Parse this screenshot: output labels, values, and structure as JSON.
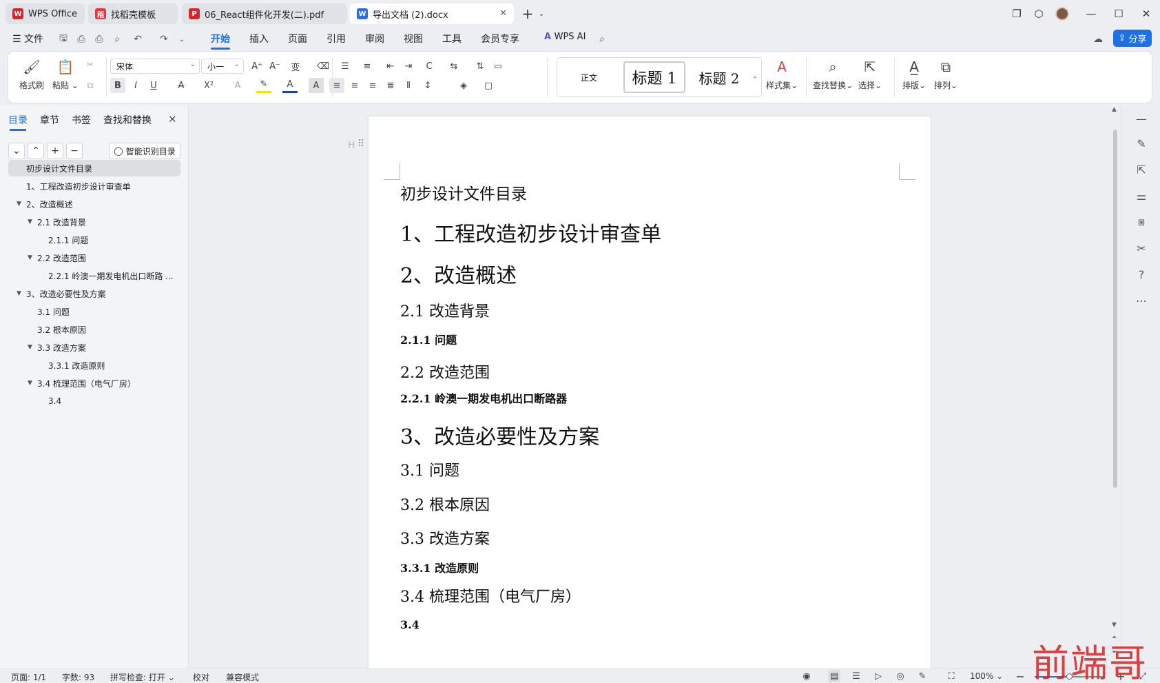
{
  "tabs": [
    {
      "label": "WPS Office",
      "icon": "W",
      "color": "#d7252c"
    },
    {
      "label": "找稻壳模板",
      "icon": "稻",
      "color": "#e6393f"
    },
    {
      "label": "06_React组件化开发(二).pdf",
      "icon": "P",
      "color": "#d7252c"
    },
    {
      "label": "导出文档 (2).docx",
      "icon": "W",
      "color": "#2b6de8"
    }
  ],
  "menu": {
    "file": "文件",
    "items": [
      "开始",
      "插入",
      "页面",
      "引用",
      "审阅",
      "视图",
      "工具",
      "会员专享"
    ],
    "active": "开始",
    "wps_ai": "WPS AI",
    "share": "分享"
  },
  "ribbon": {
    "format_painter": "格式刷",
    "paste": "粘贴",
    "font_name": "宋体",
    "font_size": "小一",
    "styles": {
      "normal": "正文",
      "h1": "标题 1",
      "h2": "标题 2"
    },
    "style_set": "样式集",
    "find_replace": "查找替换",
    "select": "选择",
    "layout": "排版",
    "arrange": "排列"
  },
  "navpane": {
    "tabs": [
      "目录",
      "章节",
      "书签",
      "查找和替换"
    ],
    "active_tab": "目录",
    "smart_button": "智能识别目录",
    "items": [
      {
        "label": "初步设计文件目录",
        "level": 0,
        "selected": true,
        "caret": false
      },
      {
        "label": "1、工程改造初步设计审查单",
        "level": 1,
        "caret": false
      },
      {
        "label": "2、改造概述",
        "level": 1,
        "caret": true
      },
      {
        "label": "2.1  改造背景",
        "level": 2,
        "caret": true
      },
      {
        "label": "2.1.1  问题",
        "level": 3,
        "caret": false
      },
      {
        "label": "2.2  改造范围",
        "level": 2,
        "caret": true
      },
      {
        "label": "2.2.1  岭澳一期发电机出口断路 ...",
        "level": 3,
        "caret": false
      },
      {
        "label": "3、改造必要性及方案",
        "level": 1,
        "caret": true
      },
      {
        "label": "3.1 问题",
        "level": 2,
        "caret": false
      },
      {
        "label": "3.2 根本原因",
        "level": 2,
        "caret": false
      },
      {
        "label": "3.3 改造方案",
        "level": 2,
        "caret": true
      },
      {
        "label": "3.3.1 改造原则",
        "level": 3,
        "caret": false
      },
      {
        "label": "3.4 梳理范围（电气厂房）",
        "level": 2,
        "caret": true
      },
      {
        "label": "3.4",
        "level": 3,
        "caret": false
      }
    ]
  },
  "document": {
    "hint": "H",
    "lines": [
      {
        "text": "初步设计文件目录",
        "style": "h2"
      },
      {
        "text": "1、工程改造初步设计审查单",
        "style": "h1"
      },
      {
        "text": "2、改造概述",
        "style": "h1"
      },
      {
        "text": "2.1  改造背景",
        "style": "h3r"
      },
      {
        "text": "2.1.1  问题",
        "style": "h4"
      },
      {
        "text": "2.2  改造范围",
        "style": "h3r"
      },
      {
        "text": "2.2.1  岭澳一期发电机出口断路器",
        "style": "h4"
      },
      {
        "text": "3、改造必要性及方案",
        "style": "h1"
      },
      {
        "text": "3.1 问题",
        "style": "h3r"
      },
      {
        "text": "3.2 根本原因",
        "style": "h3r"
      },
      {
        "text": "3.3 改造方案",
        "style": "h3r"
      },
      {
        "text": "3.3.1 改造原则",
        "style": "h4"
      },
      {
        "text": "3.4 梳理范围（电气厂房）",
        "style": "h3r"
      },
      {
        "text": "3.4",
        "style": "h4"
      }
    ]
  },
  "status": {
    "page": "页面: 1/1",
    "words": "字数: 93",
    "spell": "拼写检查: 打开",
    "proof": "校对",
    "compat": "兼容模式",
    "zoom": "100%",
    "zoom_fraction": 0.5
  },
  "watermark": "前端哥"
}
